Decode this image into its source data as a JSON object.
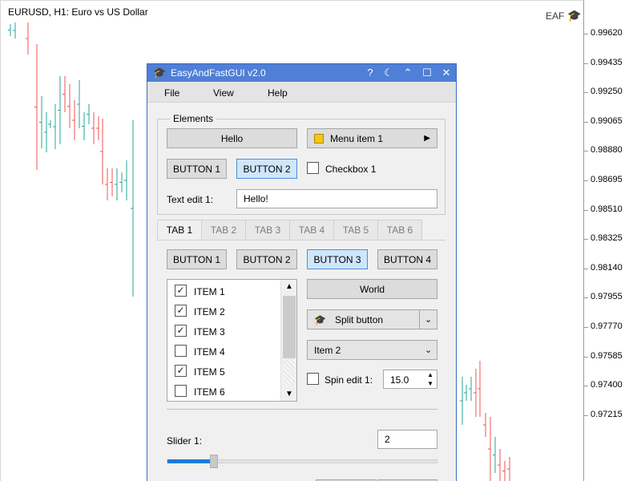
{
  "chart": {
    "title": "EURUSD, H1:  Euro vs US Dollar",
    "badge": "EAF",
    "price_labels": [
      "0.99620",
      "0.99435",
      "0.99250",
      "0.99065",
      "0.98880",
      "0.98695",
      "0.98510",
      "0.98325",
      "0.98140",
      "0.97955",
      "0.97770",
      "0.97585",
      "0.97400",
      "0.97215"
    ],
    "colors": {
      "bull": "#26a69a",
      "bear": "#ef5350",
      "axis": "#9a9a9a"
    }
  },
  "window": {
    "title": "EasyAndFastGUI v2.0",
    "title_buttons": [
      "?",
      "☾",
      "⌃",
      "☐",
      "✕"
    ],
    "accent": "#4f7fd6"
  },
  "menu": [
    "File",
    "View",
    "Help"
  ],
  "elements_group": {
    "label": "Elements",
    "hello": "Hello",
    "menu_item": "Menu item 1",
    "button1": "BUTTON 1",
    "button2": "BUTTON 2",
    "checkbox1": "Checkbox 1",
    "text_edit_label": "Text edit 1:",
    "text_edit_value": "Hello!"
  },
  "tabs": [
    "TAB 1",
    "TAB 2",
    "TAB 3",
    "TAB 4",
    "TAB 5",
    "TAB 6"
  ],
  "tab1": {
    "buttons": [
      "BUTTON 1",
      "BUTTON 2",
      "BUTTON 3",
      "BUTTON 4"
    ],
    "list_items": [
      {
        "label": "ITEM 1",
        "checked": true
      },
      {
        "label": "ITEM 2",
        "checked": true
      },
      {
        "label": "ITEM 3",
        "checked": true
      },
      {
        "label": "ITEM 4",
        "checked": false
      },
      {
        "label": "ITEM 5",
        "checked": true
      },
      {
        "label": "ITEM 6",
        "checked": false
      }
    ],
    "world": "World",
    "split_button": "Split button",
    "combo_value": "Item 2",
    "spin_label": "Spin edit 1:",
    "spin_value": "15.0",
    "slider_label": "Slider 1:",
    "slider_value": "2"
  }
}
